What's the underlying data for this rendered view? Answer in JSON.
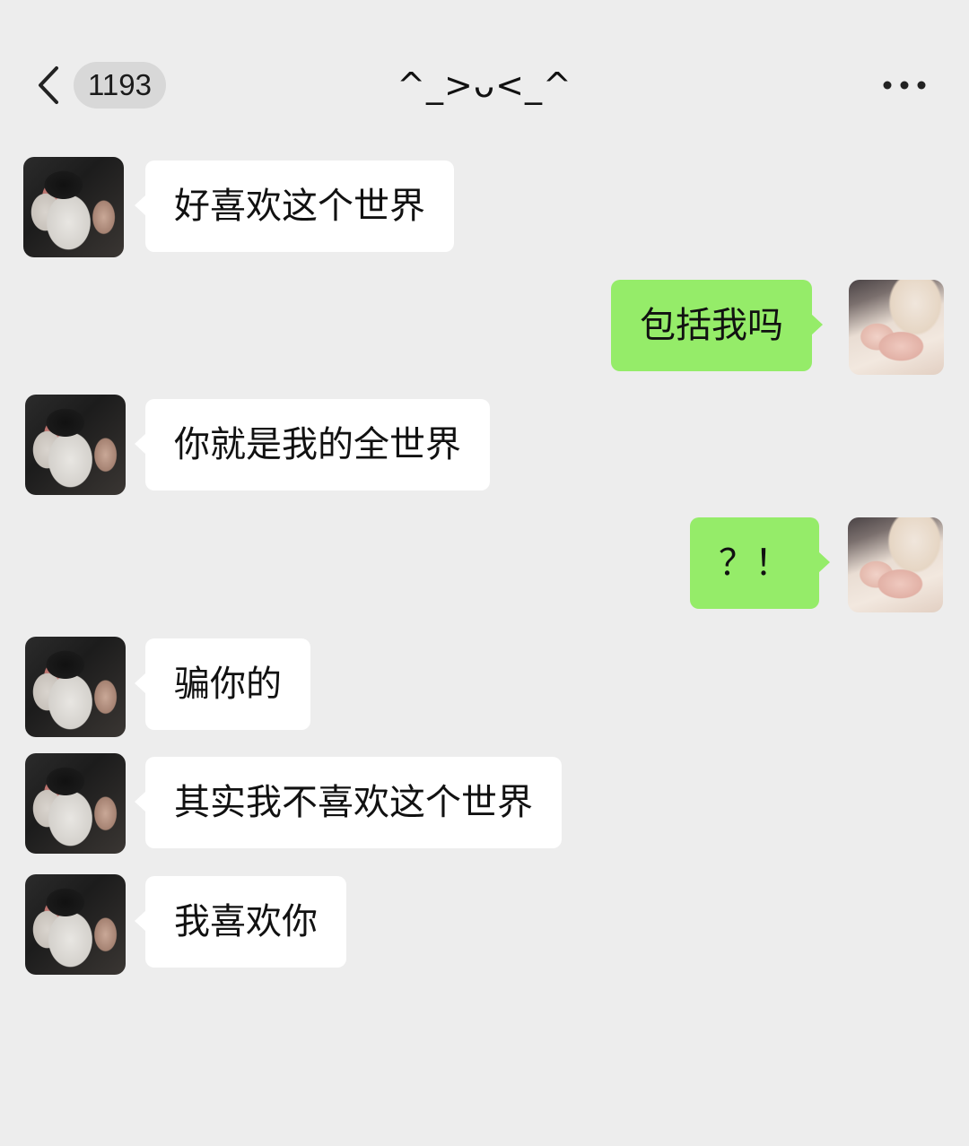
{
  "header": {
    "unread_count": "1193",
    "title": "^_>ᴗ<_^"
  },
  "messages": [
    {
      "side": "in",
      "sender": "other",
      "text": "好喜欢这个世界"
    },
    {
      "side": "out",
      "sender": "me",
      "text": "包括我吗"
    },
    {
      "side": "in",
      "sender": "other",
      "text": "你就是我的全世界"
    },
    {
      "side": "out",
      "sender": "me",
      "text": "？！"
    },
    {
      "side": "in",
      "sender": "other",
      "text": "骗你的"
    },
    {
      "side": "in",
      "sender": "other",
      "text": "其实我不喜欢这个世界"
    },
    {
      "side": "in",
      "sender": "other",
      "text": "我喜欢你"
    }
  ],
  "colors": {
    "background": "#ededed",
    "incoming_bubble": "#ffffff",
    "outgoing_bubble": "#95ec69",
    "badge": "#d8d8d8"
  },
  "icons": {
    "back": "chevron-left-icon",
    "more": "more-dots-icon"
  }
}
